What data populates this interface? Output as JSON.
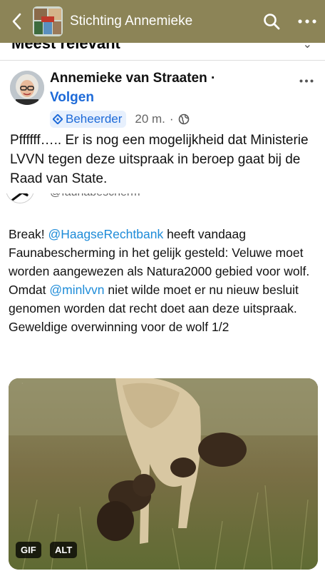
{
  "header": {
    "title": "Stichting Annemieke",
    "colors": {
      "bar": "#8c8457",
      "text": "#ffffff"
    }
  },
  "peek": {
    "text": "Meest relevant"
  },
  "post": {
    "author": "Annemieke van Straaten",
    "separator": "·",
    "follow_label": "Volgen",
    "badge": "Beheerder",
    "time": "20 m.",
    "time_separator": "·",
    "text": "Pffffff…..  Er is nog een mogelijkheid dat Ministerie LVVN tegen deze uitspraak in beroep gaat bij de Raad van State."
  },
  "embed": {
    "handle": "@faunabescherm",
    "text_parts": {
      "p1": "Break! ",
      "m1": "@HaagseRechtbank",
      "p2": " heeft vandaag Faunabescherming in het gelijk gesteld: Veluwe moet worden aangewezen als Natura2000 gebied voor wolf. Omdat ",
      "m2": "@minlvvn",
      "p3": " niet wilde moet er nu nieuw besluit genomen worden dat recht doet aan deze uitspraak. Geweldige overwinning voor de wolf 1/2"
    },
    "media": {
      "gif_label": "GIF",
      "alt_label": "ALT",
      "icon": "wolf-with-pups-image"
    }
  },
  "colors": {
    "link": "#1d6ad8",
    "mention": "#1d8bd8",
    "badge_bg": "#e7f0fd"
  }
}
